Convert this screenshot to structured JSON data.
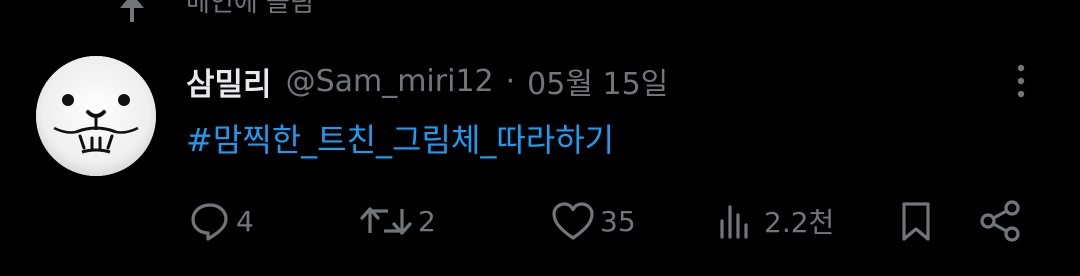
{
  "pinned": {
    "label": "메인에 올림",
    "icon": "pin-icon"
  },
  "tweet": {
    "author": {
      "display_name": "삼밀리",
      "handle": "@Sam_miri12",
      "avatar_icon": "seal-face-avatar"
    },
    "separator": "·",
    "date": "05월 15일",
    "text": "#맘찍한_트친_그림체_따라하기",
    "more_icon": "more-vertical-icon"
  },
  "actions": {
    "reply": {
      "icon": "reply-icon",
      "count": "4"
    },
    "retweet": {
      "icon": "retweet-icon",
      "count": "2"
    },
    "like": {
      "icon": "heart-icon",
      "count": "35"
    },
    "views": {
      "icon": "views-icon",
      "count": "2.2천"
    },
    "bookmark": {
      "icon": "bookmark-icon"
    },
    "share": {
      "icon": "share-icon"
    }
  },
  "colors": {
    "background": "#000000",
    "primary_text": "#e7e9ea",
    "secondary_text": "#71767b",
    "link": "#1d9bf0"
  }
}
